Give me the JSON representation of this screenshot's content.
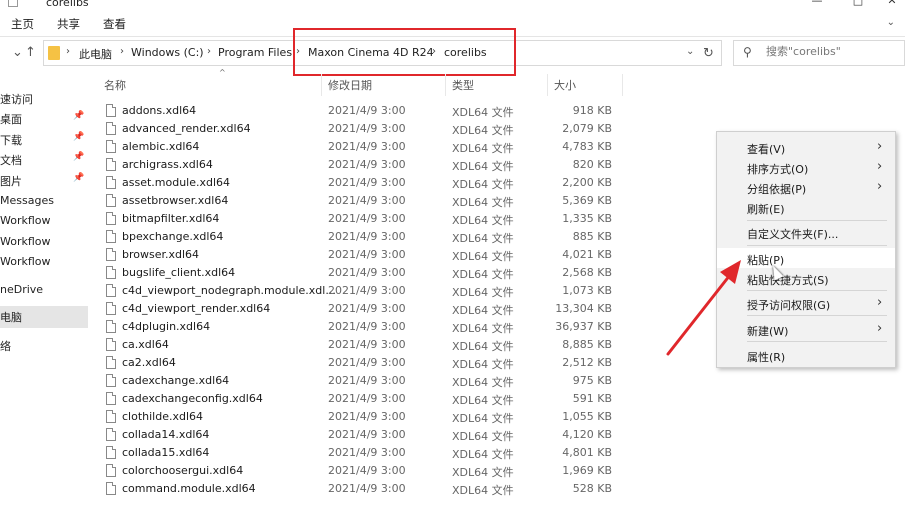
{
  "window": {
    "title": "corelibs"
  },
  "ribbon": {
    "tabs": [
      "主页",
      "共享",
      "查看"
    ]
  },
  "address": {
    "crumbs": [
      "此电脑",
      "Windows (C:)",
      "Program Files",
      "Maxon Cinema 4D R24",
      "corelibs"
    ]
  },
  "search": {
    "placeholder": "搜索\"corelibs\""
  },
  "sidebar": {
    "items": [
      {
        "label": "速访问",
        "pinned": false
      },
      {
        "label": "桌面",
        "pinned": true
      },
      {
        "label": "下载",
        "pinned": true
      },
      {
        "label": "文档",
        "pinned": true
      },
      {
        "label": "图片",
        "pinned": true
      },
      {
        "label": "Messages",
        "pinned": false
      },
      {
        "label": "Workflow",
        "pinned": false
      },
      {
        "label": "Workflow",
        "pinned": false
      },
      {
        "label": "Workflow",
        "pinned": false
      },
      {
        "label": "neDrive",
        "pinned": false
      },
      {
        "label": "电脑",
        "pinned": false
      },
      {
        "label": "络",
        "pinned": false
      }
    ]
  },
  "columns": {
    "name": "名称",
    "date": "修改日期",
    "type": "类型",
    "size": "大小"
  },
  "files": [
    {
      "name": "addons.xdl64",
      "date": "2021/4/9 3:00",
      "type": "XDL64 文件",
      "size": "918 KB"
    },
    {
      "name": "advanced_render.xdl64",
      "date": "2021/4/9 3:00",
      "type": "XDL64 文件",
      "size": "2,079 KB"
    },
    {
      "name": "alembic.xdl64",
      "date": "2021/4/9 3:00",
      "type": "XDL64 文件",
      "size": "4,783 KB"
    },
    {
      "name": "archigrass.xdl64",
      "date": "2021/4/9 3:00",
      "type": "XDL64 文件",
      "size": "820 KB"
    },
    {
      "name": "asset.module.xdl64",
      "date": "2021/4/9 3:00",
      "type": "XDL64 文件",
      "size": "2,200 KB"
    },
    {
      "name": "assetbrowser.xdl64",
      "date": "2021/4/9 3:00",
      "type": "XDL64 文件",
      "size": "5,369 KB"
    },
    {
      "name": "bitmapfilter.xdl64",
      "date": "2021/4/9 3:00",
      "type": "XDL64 文件",
      "size": "1,335 KB"
    },
    {
      "name": "bpexchange.xdl64",
      "date": "2021/4/9 3:00",
      "type": "XDL64 文件",
      "size": "885 KB"
    },
    {
      "name": "browser.xdl64",
      "date": "2021/4/9 3:00",
      "type": "XDL64 文件",
      "size": "4,021 KB"
    },
    {
      "name": "bugslife_client.xdl64",
      "date": "2021/4/9 3:00",
      "type": "XDL64 文件",
      "size": "2,568 KB"
    },
    {
      "name": "c4d_viewport_nodegraph.module.xdl...",
      "date": "2021/4/9 3:00",
      "type": "XDL64 文件",
      "size": "1,073 KB"
    },
    {
      "name": "c4d_viewport_render.xdl64",
      "date": "2021/4/9 3:00",
      "type": "XDL64 文件",
      "size": "13,304 KB"
    },
    {
      "name": "c4dplugin.xdl64",
      "date": "2021/4/9 3:00",
      "type": "XDL64 文件",
      "size": "36,937 KB"
    },
    {
      "name": "ca.xdl64",
      "date": "2021/4/9 3:00",
      "type": "XDL64 文件",
      "size": "8,885 KB"
    },
    {
      "name": "ca2.xdl64",
      "date": "2021/4/9 3:00",
      "type": "XDL64 文件",
      "size": "2,512 KB"
    },
    {
      "name": "cadexchange.xdl64",
      "date": "2021/4/9 3:00",
      "type": "XDL64 文件",
      "size": "975 KB"
    },
    {
      "name": "cadexchangeconfig.xdl64",
      "date": "2021/4/9 3:00",
      "type": "XDL64 文件",
      "size": "591 KB"
    },
    {
      "name": "clothilde.xdl64",
      "date": "2021/4/9 3:00",
      "type": "XDL64 文件",
      "size": "1,055 KB"
    },
    {
      "name": "collada14.xdl64",
      "date": "2021/4/9 3:00",
      "type": "XDL64 文件",
      "size": "4,120 KB"
    },
    {
      "name": "collada15.xdl64",
      "date": "2021/4/9 3:00",
      "type": "XDL64 文件",
      "size": "4,801 KB"
    },
    {
      "name": "colorchoosergui.xdl64",
      "date": "2021/4/9 3:00",
      "type": "XDL64 文件",
      "size": "1,969 KB"
    },
    {
      "name": "command.module.xdl64",
      "date": "2021/4/9 3:00",
      "type": "XDL64 文件",
      "size": "528 KB"
    }
  ],
  "context_menu": {
    "items": [
      {
        "label": "查看(V)",
        "submenu": true,
        "highlight": false
      },
      {
        "label": "排序方式(O)",
        "submenu": true,
        "highlight": false
      },
      {
        "label": "分组依据(P)",
        "submenu": true,
        "highlight": false
      },
      {
        "label": "刷新(E)",
        "submenu": false,
        "highlight": false
      },
      {
        "label": "自定义文件夹(F)...",
        "submenu": false,
        "highlight": false
      },
      {
        "label": "粘贴(P)",
        "submenu": false,
        "highlight": true
      },
      {
        "label": "粘贴快捷方式(S)",
        "submenu": false,
        "highlight": false
      },
      {
        "label": "授予访问权限(G)",
        "submenu": true,
        "highlight": false
      },
      {
        "label": "新建(W)",
        "submenu": true,
        "highlight": false
      },
      {
        "label": "属性(R)",
        "submenu": false,
        "highlight": false
      }
    ]
  },
  "annotation_color": "#e0272b",
  "folder_color": "#f5c244"
}
